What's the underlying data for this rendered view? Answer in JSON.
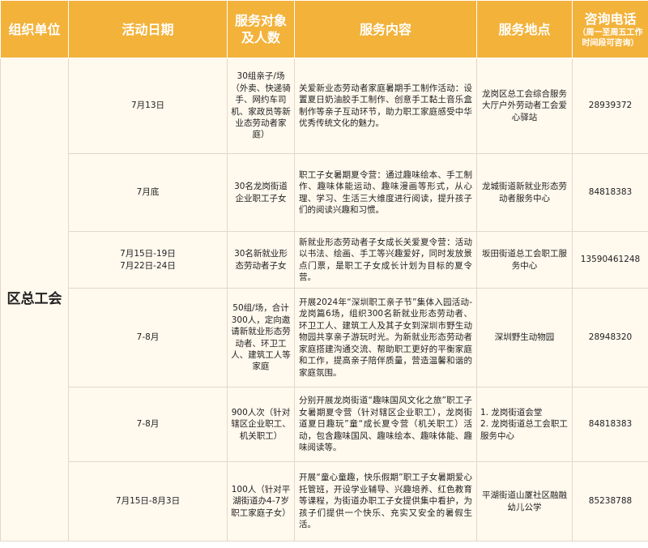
{
  "headers": {
    "org": "组织单位",
    "date": "活动日期",
    "target_line1": "服务对象",
    "target_line2": "及人数",
    "content": "服务内容",
    "location": "服务地点",
    "phone": "咨询电话",
    "phone_note_line1": "（周一至周五工作",
    "phone_note_line2": "时间段可咨询）"
  },
  "org_name": "区总工会",
  "rows": [
    {
      "date": "7月13日",
      "target": "30组亲子/场（外卖、快递骑手、网约车司机、家政员等新业态劳动者家庭）",
      "content": "关爱新业态劳动者家庭暑期手工制作活动：设置夏日奶油胶手工制作、创意手工黏土音乐盒制作等亲子互动环节，助力职工家庭感受中华优秀传统文化的魅力。",
      "location": "龙岗区总工会综合服务大厅户外劳动者工会爱心驿站",
      "phone": "28939372"
    },
    {
      "date": "7月底",
      "target": "30名龙岗街道企业职工子女",
      "content": "职工子女暑期夏令营：通过趣味绘本、手工制作、趣味体能运动、趣味漫画等形式，从心理、学习、生活三大维度进行阅读，提升孩子们的阅读兴趣和习惯。",
      "location": "龙城街道新就业形态劳动者服务中心",
      "phone": "84818383"
    },
    {
      "date": "7月15日-19日",
      "date2": "7月22日-24日",
      "target": "30名新就业形态劳动者子女",
      "content": "新就业形态劳动者子女成长关爱夏令营：活动以书法、绘画、手工等兴趣爱好，同时发放景点门票，是职工子女成长计划为目标的夏令营。",
      "location": "坂田街道总工会职工服务中心",
      "phone": "13590461248"
    },
    {
      "date": "7-8月",
      "target": "50组/场，合计300人，定向邀请新就业形态劳动者、环卫工人、建筑工人等家庭",
      "content": "开展2024年“深圳职工亲子节”集体入园活动-龙岗篇6场，组织300名新就业形态劳动者、环卫工人、建筑工人及其子女到深圳市野生动物园共享亲子游玩时光。为新就业形态劳动者家庭搭建沟通交流、帮助职工更好的平衡家庭和工作，提高亲子陪伴质量，营造温馨和谐的家庭氛围。",
      "location": "深圳野生动物园",
      "phone": "28948320"
    },
    {
      "date": "7-8月",
      "target": "900人次（针对辖区企业职工、机关职工）",
      "content": "分别开展龙岗街道“趣味国风文化之旅”职工子女暑期夏令营（针对辖区企业职工），龙岗街道夏日趣玩”童“成长夏令营（机关职工）活动，包含趣味国风、趣味绘本、趣味体能、趣味阅读等。",
      "location_line1": "1. 龙岗街道会堂",
      "location_line2": "2. 龙岗街道总工会职工服务中心",
      "phone": "84818383"
    },
    {
      "date": "7月15日-8月3日",
      "target": "100人（针对平湖街道办4-7岁职工家庭子女）",
      "content": "开展“童心童趣，快乐假期”职工子女暑期爱心托管班，开设学业辅导、兴趣培养、红色教育等课程，为街道办职工子女提供集中看护，为孩子们提供一个快乐、充实又安全的暑假生活。",
      "location": "平湖街道山厦社区融融幼儿公学",
      "phone": "85238788"
    }
  ],
  "colors": {
    "header_bg": "#f3b23a",
    "header_text": "#ffffff",
    "row_bg": "#fff9ee"
  }
}
